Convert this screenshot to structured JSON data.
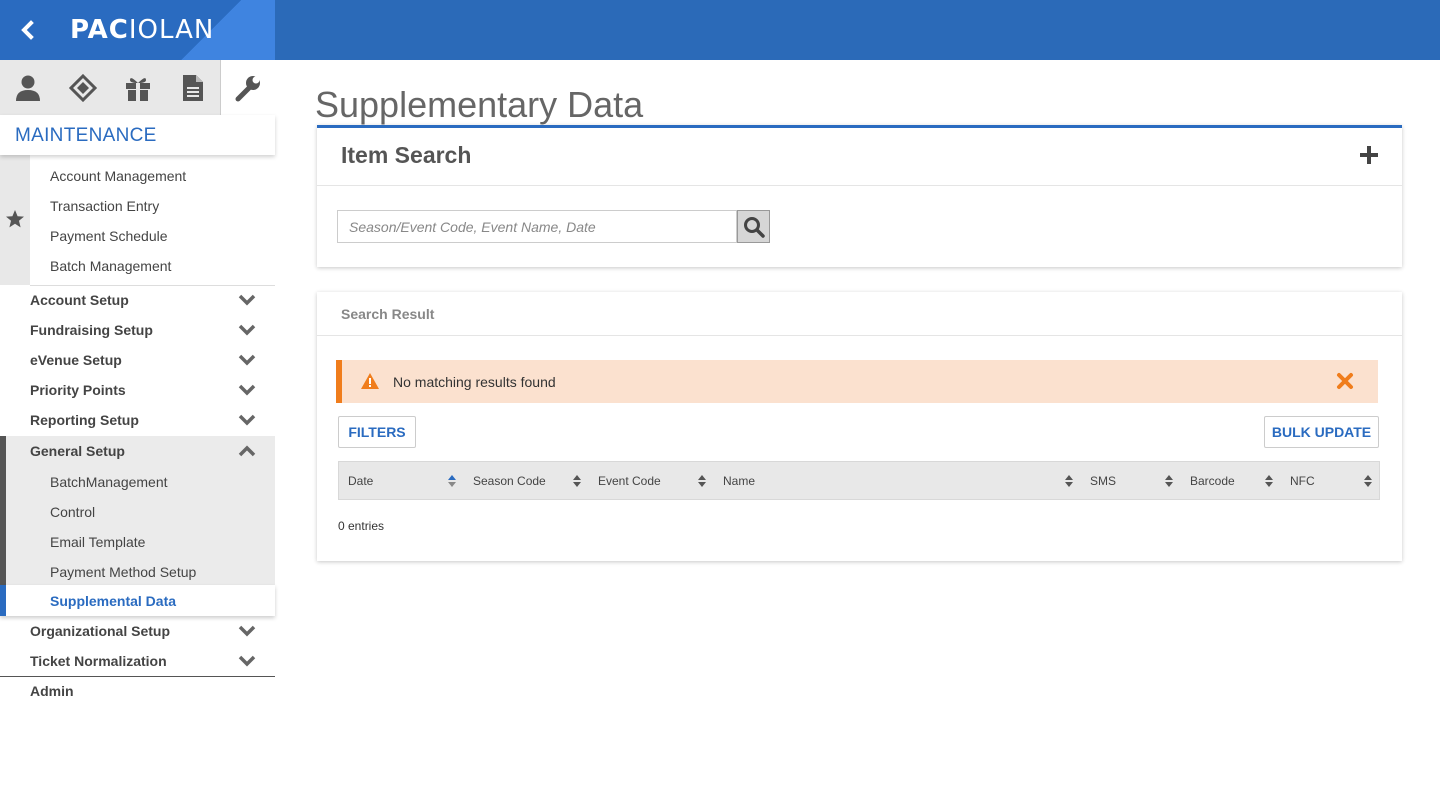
{
  "brand": {
    "logo_bold": "PAC",
    "logo_thin": "IOLAN"
  },
  "sidebar": {
    "section_title": "MAINTENANCE",
    "icon_tabs": [
      "person-icon",
      "ticket-icon",
      "gift-icon",
      "document-icon",
      "wrench-icon"
    ],
    "favorites": [
      "Account Management",
      "Transaction Entry",
      "Payment Schedule",
      "Batch Management"
    ],
    "groups_top": [
      "Account Setup",
      "Fundraising Setup",
      "eVenue Setup",
      "Priority Points",
      "Reporting Setup"
    ],
    "open_group": {
      "label": "General Setup",
      "items": [
        "BatchManagement",
        "Control",
        "Email Template",
        "Payment Method Setup"
      ],
      "active_item": "Supplemental Data"
    },
    "groups_bottom": [
      "Organizational Setup",
      "Ticket Normalization"
    ],
    "admin": "Admin"
  },
  "main": {
    "page_title": "Supplementary Data",
    "item_search": {
      "title": "Item Search",
      "placeholder": "Season/Event Code, Event Name, Date"
    },
    "result": {
      "title": "Search Result",
      "alert": "No matching results found",
      "filters_label": "FILTERS",
      "bulk_update_label": "BULK UPDATE",
      "columns": [
        "Date",
        "Season Code",
        "Event Code",
        "Name",
        "SMS",
        "Barcode",
        "NFC"
      ],
      "entries_text": "0 entries"
    }
  },
  "colors": {
    "brand_blue": "#2a6bc0",
    "alert_bg": "#fbe1cf",
    "alert_accent": "#f07d1c"
  }
}
